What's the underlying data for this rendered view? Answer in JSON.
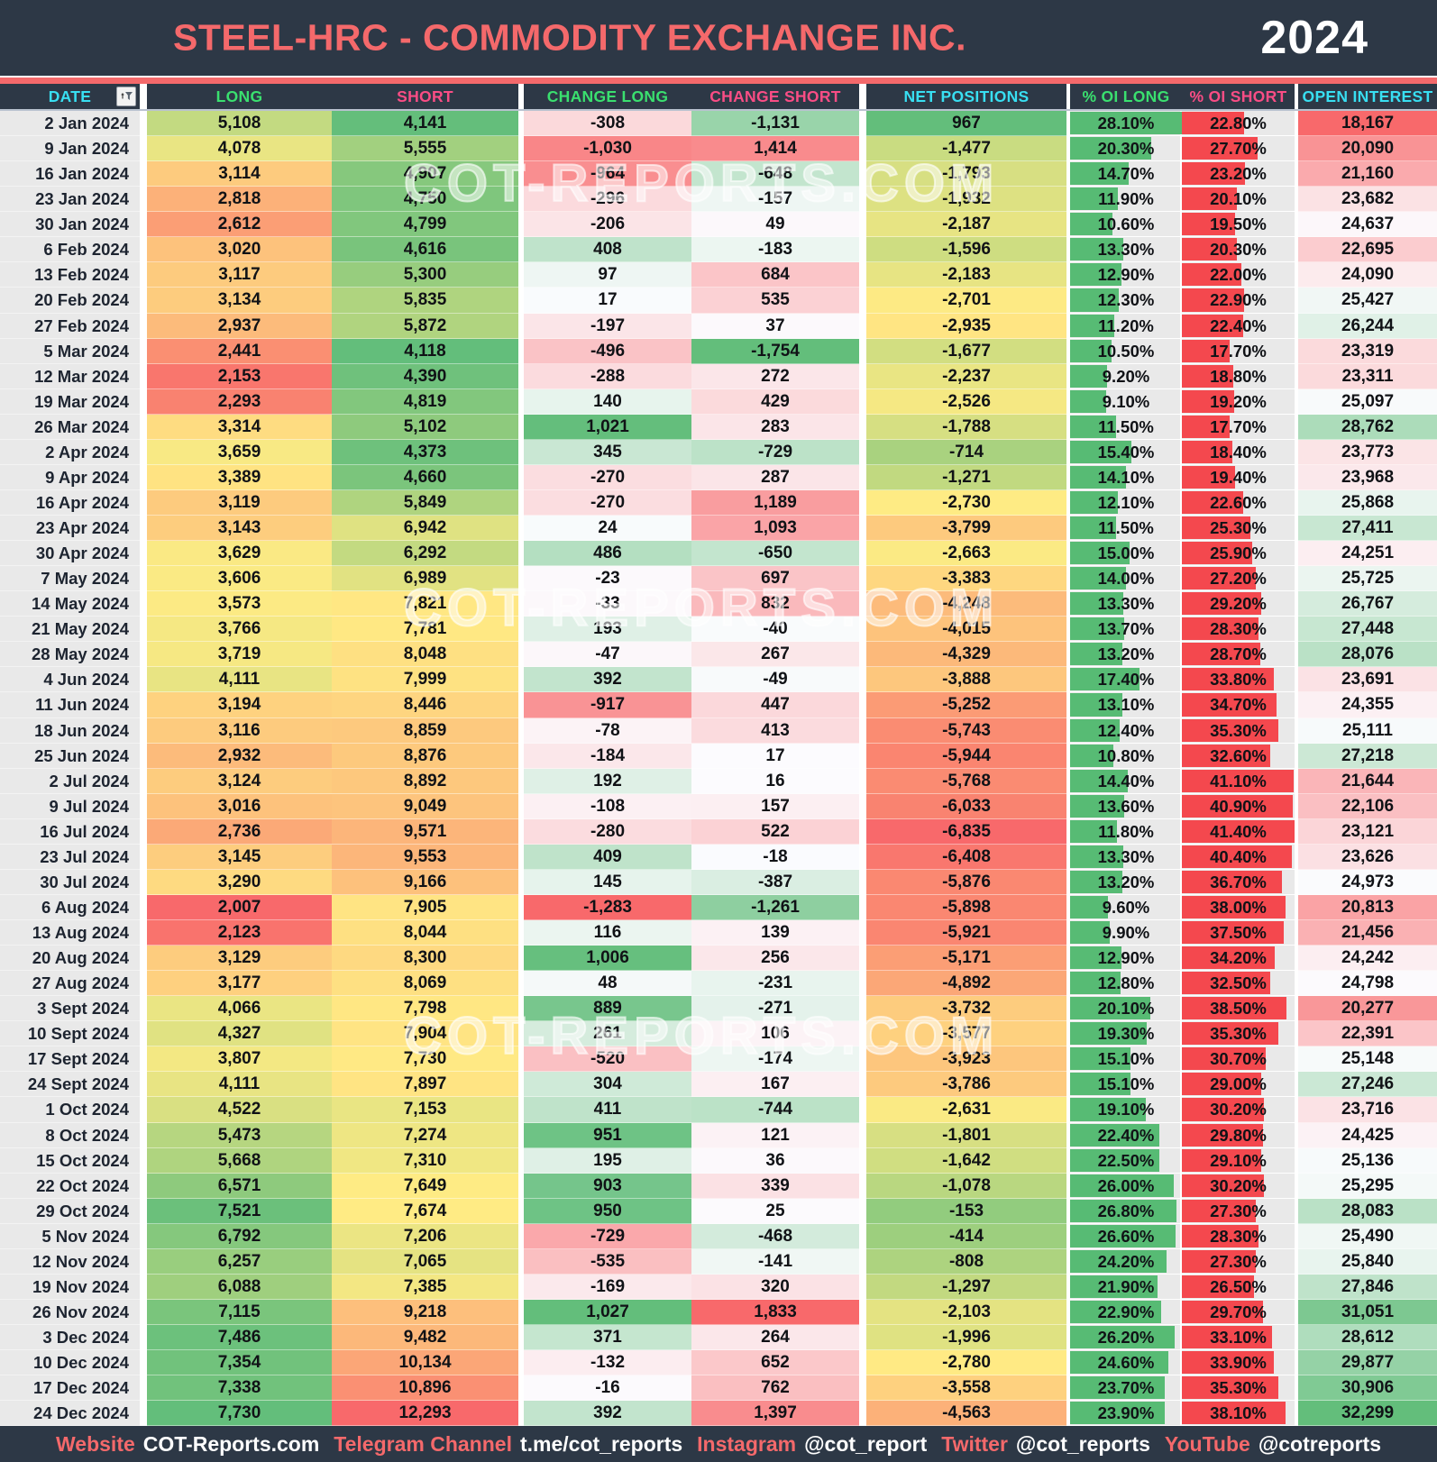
{
  "header": {
    "title": "STEEL-HRC - COMMODITY EXCHANGE INC.",
    "year": "2024"
  },
  "watermark": {
    "text": "COT-REPORTS.COM"
  },
  "colors": {
    "navy": "#2d3846",
    "salmon": "#f4696b",
    "header_cyan": "#38dff2",
    "header_green": "#3ae06f",
    "header_pink": "#fa4d85",
    "heat_red": "#f8696b",
    "heat_yellow": "#ffeb84",
    "heat_green": "#63be7b",
    "heat_white": "#fcfcff",
    "bar_green": "#57bb74",
    "bar_red": "#f4484e",
    "bar_bg": "#e9e9e9"
  },
  "chart_data": {
    "type": "table",
    "title": "STEEL-HRC - COMMODITY EXCHANGE INC. 2024",
    "columns": [
      {
        "key": "date",
        "label": "DATE",
        "color": "cyan"
      },
      {
        "key": "long",
        "label": "LONG",
        "color": "green"
      },
      {
        "key": "short",
        "label": "SHORT",
        "color": "pink"
      },
      {
        "key": "change_long",
        "label": "CHANGE LONG",
        "color": "green"
      },
      {
        "key": "change_short",
        "label": "CHANGE SHORT",
        "color": "pink"
      },
      {
        "key": "net_positions",
        "label": "NET POSITIONS",
        "color": "cyan"
      },
      {
        "key": "oi_long_pct",
        "label": "% OI LONG",
        "color": "green"
      },
      {
        "key": "oi_short_pct",
        "label": "% OI SHORT",
        "color": "pink"
      },
      {
        "key": "open_interest",
        "label": "OPEN INTEREST",
        "color": "cyan"
      }
    ],
    "rows": [
      [
        "2 Jan 2024",
        5108,
        4141,
        -308,
        -1131,
        967,
        28.1,
        22.8,
        18167
      ],
      [
        "9 Jan 2024",
        4078,
        5555,
        -1030,
        1414,
        -1477,
        20.3,
        27.7,
        20090
      ],
      [
        "16 Jan 2024",
        3114,
        4907,
        -964,
        -648,
        -1793,
        14.7,
        23.2,
        21160
      ],
      [
        "23 Jan 2024",
        2818,
        4750,
        -296,
        -157,
        -1932,
        11.9,
        20.1,
        23682
      ],
      [
        "30 Jan 2024",
        2612,
        4799,
        -206,
        49,
        -2187,
        10.6,
        19.5,
        24637
      ],
      [
        "6 Feb 2024",
        3020,
        4616,
        408,
        -183,
        -1596,
        13.3,
        20.3,
        22695
      ],
      [
        "13 Feb 2024",
        3117,
        5300,
        97,
        684,
        -2183,
        12.9,
        22.0,
        24090
      ],
      [
        "20 Feb 2024",
        3134,
        5835,
        17,
        535,
        -2701,
        12.3,
        22.9,
        25427
      ],
      [
        "27 Feb 2024",
        2937,
        5872,
        -197,
        37,
        -2935,
        11.2,
        22.4,
        26244
      ],
      [
        "5 Mar 2024",
        2441,
        4118,
        -496,
        -1754,
        -1677,
        10.5,
        17.7,
        23319
      ],
      [
        "12 Mar 2024",
        2153,
        4390,
        -288,
        272,
        -2237,
        9.2,
        18.8,
        23311
      ],
      [
        "19 Mar 2024",
        2293,
        4819,
        140,
        429,
        -2526,
        9.1,
        19.2,
        25097
      ],
      [
        "26 Mar 2024",
        3314,
        5102,
        1021,
        283,
        -1788,
        11.5,
        17.7,
        28762
      ],
      [
        "2 Apr 2024",
        3659,
        4373,
        345,
        -729,
        -714,
        15.4,
        18.4,
        23773
      ],
      [
        "9 Apr 2024",
        3389,
        4660,
        -270,
        287,
        -1271,
        14.1,
        19.4,
        23968
      ],
      [
        "16 Apr 2024",
        3119,
        5849,
        -270,
        1189,
        -2730,
        12.1,
        22.6,
        25868
      ],
      [
        "23 Apr 2024",
        3143,
        6942,
        24,
        1093,
        -3799,
        11.5,
        25.3,
        27411
      ],
      [
        "30 Apr 2024",
        3629,
        6292,
        486,
        -650,
        -2663,
        15.0,
        25.9,
        24251
      ],
      [
        "7 May 2024",
        3606,
        6989,
        -23,
        697,
        -3383,
        14.0,
        27.2,
        25725
      ],
      [
        "14 May 2024",
        3573,
        7821,
        -33,
        832,
        -4248,
        13.3,
        29.2,
        26767
      ],
      [
        "21 May 2024",
        3766,
        7781,
        193,
        -40,
        -4015,
        13.7,
        28.3,
        27448
      ],
      [
        "28 May 2024",
        3719,
        8048,
        -47,
        267,
        -4329,
        13.2,
        28.7,
        28076
      ],
      [
        "4 Jun 2024",
        4111,
        7999,
        392,
        -49,
        -3888,
        17.4,
        33.8,
        23691
      ],
      [
        "11 Jun 2024",
        3194,
        8446,
        -917,
        447,
        -5252,
        13.1,
        34.7,
        24355
      ],
      [
        "18 Jun 2024",
        3116,
        8859,
        -78,
        413,
        -5743,
        12.4,
        35.3,
        25111
      ],
      [
        "25 Jun 2024",
        2932,
        8876,
        -184,
        17,
        -5944,
        10.8,
        32.6,
        27218
      ],
      [
        "2 Jul 2024",
        3124,
        8892,
        192,
        16,
        -5768,
        14.4,
        41.1,
        21644
      ],
      [
        "9 Jul 2024",
        3016,
        9049,
        -108,
        157,
        -6033,
        13.6,
        40.9,
        22106
      ],
      [
        "16 Jul 2024",
        2736,
        9571,
        -280,
        522,
        -6835,
        11.8,
        41.4,
        23121
      ],
      [
        "23 Jul 2024",
        3145,
        9553,
        409,
        -18,
        -6408,
        13.3,
        40.4,
        23626
      ],
      [
        "30 Jul 2024",
        3290,
        9166,
        145,
        -387,
        -5876,
        13.2,
        36.7,
        24973
      ],
      [
        "6 Aug 2024",
        2007,
        7905,
        -1283,
        -1261,
        -5898,
        9.6,
        38.0,
        20813
      ],
      [
        "13 Aug 2024",
        2123,
        8044,
        116,
        139,
        -5921,
        9.9,
        37.5,
        21456
      ],
      [
        "20 Aug 2024",
        3129,
        8300,
        1006,
        256,
        -5171,
        12.9,
        34.2,
        24242
      ],
      [
        "27 Aug 2024",
        3177,
        8069,
        48,
        -231,
        -4892,
        12.8,
        32.5,
        24798
      ],
      [
        "3 Sept 2024",
        4066,
        7798,
        889,
        -271,
        -3732,
        20.1,
        38.5,
        20277
      ],
      [
        "10 Sept 2024",
        4327,
        7904,
        261,
        106,
        -3577,
        19.3,
        35.3,
        22391
      ],
      [
        "17 Sept 2024",
        3807,
        7730,
        -520,
        -174,
        -3923,
        15.1,
        30.7,
        25148
      ],
      [
        "24 Sept 2024",
        4111,
        7897,
        304,
        167,
        -3786,
        15.1,
        29.0,
        27246
      ],
      [
        "1 Oct 2024",
        4522,
        7153,
        411,
        -744,
        -2631,
        19.1,
        30.2,
        23716
      ],
      [
        "8 Oct 2024",
        5473,
        7274,
        951,
        121,
        -1801,
        22.4,
        29.8,
        24425
      ],
      [
        "15 Oct 2024",
        5668,
        7310,
        195,
        36,
        -1642,
        22.5,
        29.1,
        25136
      ],
      [
        "22 Oct 2024",
        6571,
        7649,
        903,
        339,
        -1078,
        26.0,
        30.2,
        25295
      ],
      [
        "29 Oct 2024",
        7521,
        7674,
        950,
        25,
        -153,
        26.8,
        27.3,
        28083
      ],
      [
        "5 Nov 2024",
        6792,
        7206,
        -729,
        -468,
        -414,
        26.6,
        28.3,
        25490
      ],
      [
        "12 Nov 2024",
        6257,
        7065,
        -535,
        -141,
        -808,
        24.2,
        27.3,
        25840
      ],
      [
        "19 Nov 2024",
        6088,
        7385,
        -169,
        320,
        -1297,
        21.9,
        26.5,
        27846
      ],
      [
        "26 Nov 2024",
        7115,
        9218,
        1027,
        1833,
        -2103,
        22.9,
        29.7,
        31051
      ],
      [
        "3 Dec 2024",
        7486,
        9482,
        371,
        264,
        -1996,
        26.2,
        33.1,
        28612
      ],
      [
        "10 Dec 2024",
        7354,
        10134,
        -132,
        652,
        -2780,
        24.6,
        33.9,
        29877
      ],
      [
        "17 Dec 2024",
        7338,
        10896,
        -16,
        762,
        -3558,
        23.7,
        35.3,
        30906
      ],
      [
        "24 Dec 2024",
        7730,
        12293,
        392,
        1397,
        -4563,
        23.9,
        38.1,
        32299
      ]
    ]
  },
  "footer": {
    "items": [
      {
        "label": "Website",
        "value": "COT-Reports.com"
      },
      {
        "label": "Telegram Channel",
        "value": "t.me/cot_reports"
      },
      {
        "label": "Instagram",
        "value": "@cot_report"
      },
      {
        "label": "Twitter",
        "value": "@cot_reports"
      },
      {
        "label": "YouTube",
        "value": "@cotreports"
      }
    ]
  }
}
